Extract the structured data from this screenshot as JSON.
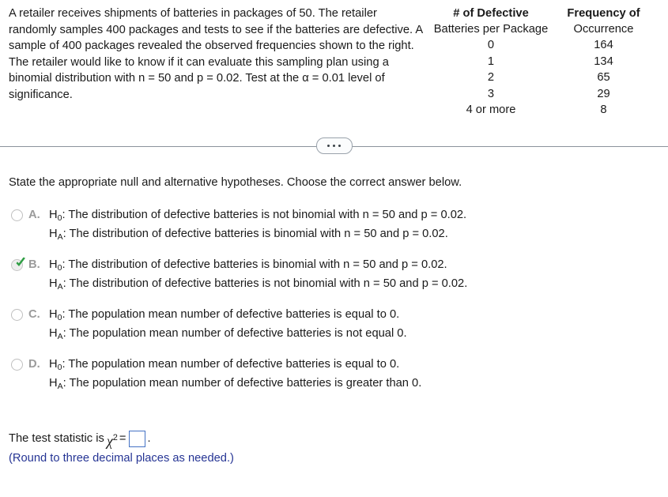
{
  "problem": {
    "stem_segments": [
      "A retailer receives shipments of batteries in packages of 50. The retailer randomly samples 400 packages and tests to see if the batteries are defective. A sample of 400 packages revealed the observed frequencies shown to the right. The retailer would like to know if it can evaluate this sampling plan using a binomial distribution with n = 50 and p = 0.02. Test at the ",
      "α = 0.01",
      " level of significance."
    ],
    "stem_full": "A retailer receives shipments of batteries in packages of 50. The retailer randomly samples 400 packages and tests to see if the batteries are defective. A sample of 400 packages revealed the observed frequencies shown to the right. The retailer would like to know if it can evaluate this sampling plan using a binomial distribution with n = 50 and p = 0.02. Test at the α = 0.01 level of significance."
  },
  "frequency_table": {
    "headers": [
      {
        "line1": "# of Defective",
        "line2": "Batteries per Package"
      },
      {
        "line1": "Frequency of",
        "line2": "Occurrence"
      }
    ],
    "rows": [
      {
        "category": "0",
        "frequency": "164"
      },
      {
        "category": "1",
        "frequency": "134"
      },
      {
        "category": "2",
        "frequency": "65"
      },
      {
        "category": "3",
        "frequency": "29"
      },
      {
        "category": "4 or more",
        "frequency": "8"
      }
    ]
  },
  "divider": {
    "ellipsis_label": "..."
  },
  "prompt": "State the appropriate null and alternative hypotheses. Choose the correct answer below.",
  "choices": [
    {
      "letter": "A.",
      "selected": false,
      "null_symbol": "H",
      "null_sub": "0",
      "null_text": ": The distribution of defective batteries is not binomial with n = 50 and p = 0.02.",
      "alt_symbol": "H",
      "alt_sub": "A",
      "alt_text": ": The distribution of defective batteries is binomial with n = 50 and p = 0.02."
    },
    {
      "letter": "B.",
      "selected": true,
      "null_symbol": "H",
      "null_sub": "0",
      "null_text": ": The distribution of defective batteries is binomial with n = 50 and p = 0.02.",
      "alt_symbol": "H",
      "alt_sub": "A",
      "alt_text": ": The distribution of defective batteries is not binomial with n = 50 and p = 0.02."
    },
    {
      "letter": "C.",
      "selected": false,
      "null_symbol": "H",
      "null_sub": "0",
      "null_text": ": The population mean number of defective batteries is equal to 0.",
      "alt_symbol": "H",
      "alt_sub": "A",
      "alt_text": ": The population mean number of defective batteries is not equal 0."
    },
    {
      "letter": "D.",
      "selected": false,
      "null_symbol": "H",
      "null_sub": "0",
      "null_text": ": The population mean number of defective batteries is equal to 0.",
      "alt_symbol": "H",
      "alt_sub": "A",
      "alt_text": ": The population mean number of defective batteries is greater than 0."
    }
  ],
  "test_statistic": {
    "label_prefix": "The test statistic is",
    "chi_symbol": "χ",
    "chi_exponent": "2",
    "equals": "=",
    "input_value": "",
    "input_placeholder": "",
    "trailing_period": ".",
    "round_note": "(Round to three decimal places as needed.)"
  },
  "colors": {
    "text": "#1a1a1a",
    "choice_letter": "#9b9b9b",
    "note_blue": "#253494",
    "input_border": "#4472c4",
    "divider": "#8b939c",
    "check_green": "#2f9e44"
  }
}
